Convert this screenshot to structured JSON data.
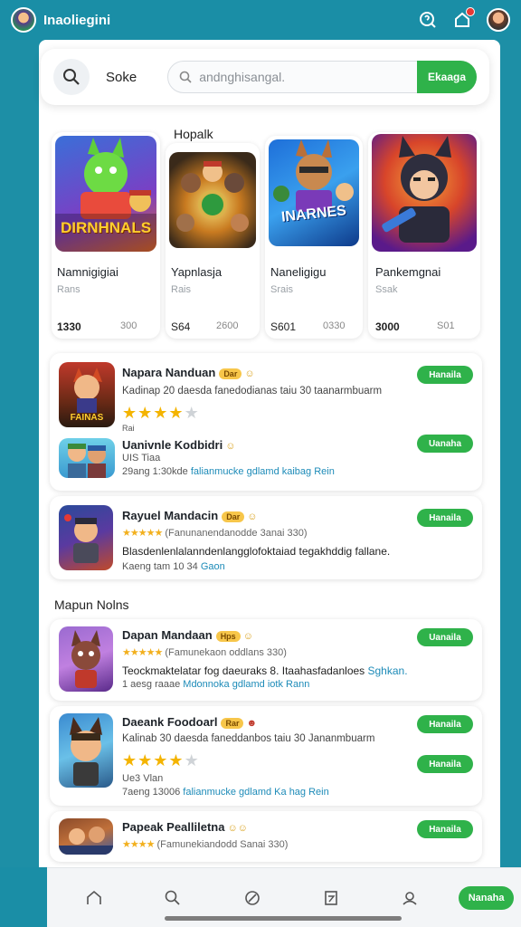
{
  "header": {
    "app_title": "Inaoliegini",
    "icons": [
      "help-icon",
      "notification-icon",
      "profile-avatar"
    ]
  },
  "search": {
    "label": "Soke",
    "placeholder": "andnghisangal.",
    "button_label": "Ekaaga"
  },
  "featured": {
    "title": "Hopalk",
    "cards": [
      {
        "name": "Namnigigiai",
        "category": "Rans",
        "num1": "1330",
        "num2": "300",
        "art_text": "DIRNHNALS"
      },
      {
        "name": "Yapnlasja",
        "category": "Rais",
        "num1": "S64",
        "num2": "2600"
      },
      {
        "name": "Naneligigu",
        "category": "Srais",
        "num1": "S601",
        "num2": "0330",
        "art_text": "INARNES"
      },
      {
        "name": "Pankemgnai",
        "category": "Ssak",
        "num1": "3000",
        "num2": "S01"
      }
    ]
  },
  "list_top": [
    {
      "name": "Napara Nanduan",
      "badge": "Dar",
      "emoji": "☺",
      "desc": "Kadinap 20 daesda fanedodianas taiu 30 taanarmbuarm",
      "stars_on": 4,
      "stars_total": 5,
      "sub": "Rai",
      "button": "Hanaila",
      "art_text": "FAINAS"
    },
    {
      "name": "Uanivnle Kodbidri",
      "emoji": "☺",
      "meta1": "UIS Tiaa",
      "meta2_plain": "29ang 1:30kde ",
      "meta2_link": "falianmucke gdlamd kaibag Rein",
      "button": "Uanaha"
    }
  ],
  "list_mid": {
    "name": "Rayuel Mandacin",
    "badge": "Dar",
    "emoji": "☺",
    "rating_stars": "★★★★★",
    "rating_text": "(Fanunanendanodde 3anai 330)",
    "desc": "Blasdenlenlalanndenlangglofoktaiad tegakhddig fallane.",
    "meta_plain": "Kaeng tam 10 34 ",
    "meta_link": "Gaon",
    "button": "Hanaila"
  },
  "section": {
    "title": "Mapun Nolns"
  },
  "list_bottom": [
    {
      "name": "Dapan Mandaan",
      "badge": "Hps",
      "emoji": "☺",
      "rating_stars": "★★★★★",
      "rating_text": "(Famunekaon oddlans 330)",
      "desc_plain": "Teockmaktelatar fog daeuraks 8. Itaahasfadanloes ",
      "desc_link": "Sghkan.",
      "meta_plain": "1 aesg raaae ",
      "meta_link": "Mdonnoka gdlamd iotk Rann",
      "button": "Uanaila"
    },
    {
      "name": "Daeank Foodoarl",
      "badge": "Rar",
      "emoji": "☻",
      "desc": "Kalinab 30 daesda faneddanbos taiu 30 Jananmbuarm",
      "stars_on": 4,
      "stars_total": 5,
      "meta1": "Ue3 Vlan",
      "meta2_plain": "7aeng 13006 ",
      "meta2_link": "falianmucke gdlamd Ka hag Rein",
      "button": "Hanaila",
      "button2": "Hanaila"
    },
    {
      "name": "Papeak Pealliletna",
      "emoji": "☺☺",
      "rating_stars": "★★★★",
      "rating_text": "(Famunekiandodd Sanai 330)",
      "button": "Hanaila"
    }
  ],
  "bottom_nav": {
    "items": [
      "home-icon",
      "search-icon",
      "discover-icon",
      "library-icon",
      "profile-icon"
    ],
    "cta_label": "Nanaha"
  },
  "colors": {
    "accent": "#2fb24a",
    "teal": "#1a8ea6",
    "star": "#f4b400",
    "link": "#1d8bb8"
  }
}
